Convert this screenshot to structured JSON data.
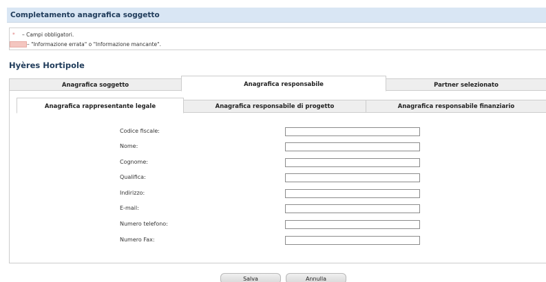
{
  "header": {
    "title": "Completamento anagrafica soggetto"
  },
  "legend": {
    "required_symbol": "*",
    "required_text": "– Campi obbligatori.",
    "error_text": "– \"Informazione errata\" o \"Informazione mancante\".",
    "error_color": "#f4c6c0"
  },
  "subject": {
    "name": "Hyères Hortipole"
  },
  "main_tabs": [
    {
      "label": "Anagrafica soggetto",
      "active": false
    },
    {
      "label": "Anagrafica responsabile",
      "active": true
    },
    {
      "label": "Partner selezionato",
      "active": false
    }
  ],
  "sub_tabs": [
    {
      "label": "Anagrafica rappresentante legale",
      "active": true
    },
    {
      "label": "Anagrafica responsabile di progetto",
      "active": false
    },
    {
      "label": "Anagrafica responsabile finanziario",
      "active": false
    }
  ],
  "form": {
    "fields": [
      {
        "label": "Codice fiscale:",
        "value": ""
      },
      {
        "label": "Nome:",
        "value": ""
      },
      {
        "label": "Cognome:",
        "value": ""
      },
      {
        "label": "Qualifica:",
        "value": ""
      },
      {
        "label": "Indirizzo:",
        "value": ""
      },
      {
        "label": "E-mail:",
        "value": ""
      },
      {
        "label": "Numero telefono:",
        "value": ""
      },
      {
        "label": "Numero Fax:",
        "value": ""
      }
    ]
  },
  "buttons": {
    "save_label": "Salva",
    "cancel_label": "Annulla"
  }
}
